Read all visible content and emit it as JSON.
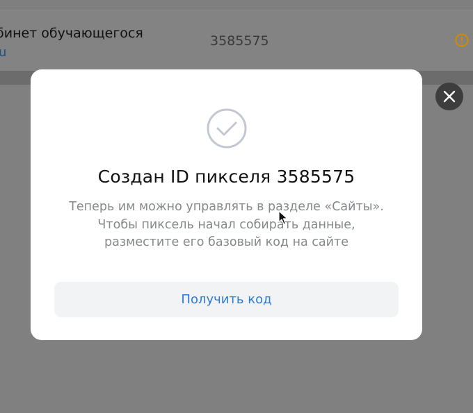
{
  "background": {
    "row": {
      "name": "бинет обучающегося",
      "link": "u",
      "id": "3585575",
      "status_icon": "warning-icon"
    }
  },
  "modal": {
    "icon": "check-circle-icon",
    "title": "Создан ID пикселя 3585575",
    "description": "Теперь им можно управлять в разделе «Сайты». Чтобы пиксель начал собирать данные, разместите его базовый код на сайте",
    "button_label": "Получить код",
    "close_icon": "close-icon"
  },
  "colors": {
    "accent": "#2b7bd6",
    "warning": "#d38a00",
    "overlay": "#808080"
  }
}
